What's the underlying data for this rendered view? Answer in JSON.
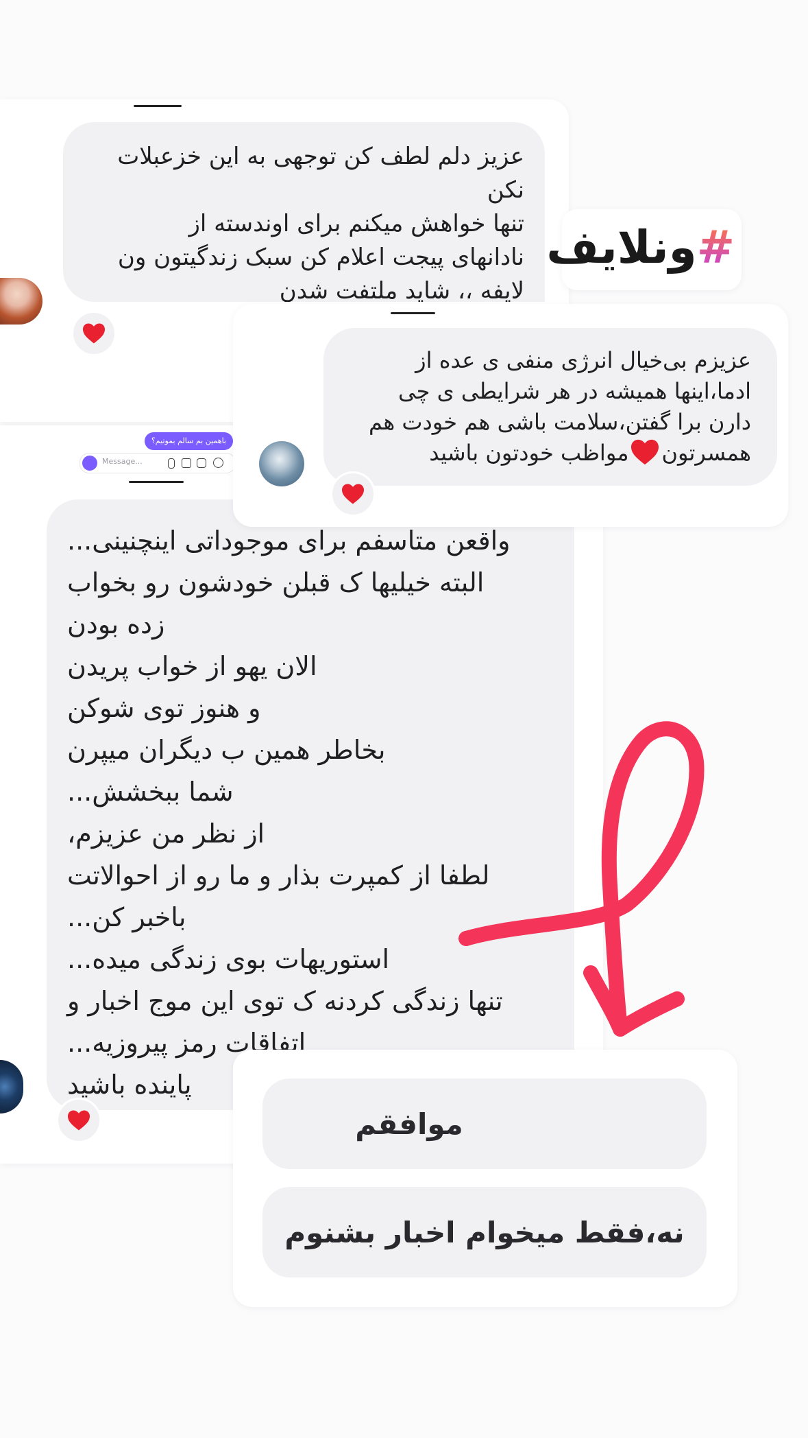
{
  "brand": {
    "logo_text": "ونلایف",
    "hash_symbol": "#"
  },
  "comments": [
    {
      "lines": [
        "عزیز دلم لطف کن توجهی به این خزعبلات",
        "نکن",
        "تنها خواهش میکنم برای اوندسته از",
        "نادانهای پیجت اعلام کن سبک زندگیتون ون",
        "لایفه ،، شاید ملتفت شدن"
      ],
      "reaction": "heart"
    },
    {
      "lines": [
        "عزیزم بی‌خیال انرژی منفی ی عده از",
        "ادما،اینها همیشه در هر شرایطی ی چی",
        "دارن برا گفتن،سلامت باشی هم خودت هم",
        "همسرتون",
        "مواظب خودتون باشید"
      ],
      "reaction": "heart"
    },
    {
      "lines": [
        "واقعن متاسفم برای موجوداتی اینچنینی...",
        "البته خیلیها ک قبلن خودشون رو بخواب",
        "زده بودن",
        "الان یهو از خواب پریدن",
        "و هنوز توی شوکن",
        "بخاطر همین ب دیگران میپرن",
        "شما ببخشش...",
        "از نظر من عزیزم،",
        "لطفا از کمپرت بذار و ما رو از احوالاتت",
        "باخبر کن...",
        "استوریهات بوی زندگی میده...",
        "تنها زندگی کردنه ک توی این موج اخبار و",
        "اتفاقات رمز پیروزیه...",
        "پاینده باشید"
      ],
      "reaction": "heart"
    }
  ],
  "chat_preview": {
    "bubble_text": "باهمین بم سالم بموتیم؟",
    "message_placeholder": "Message..."
  },
  "poll": {
    "options": [
      "موافقم",
      "نه،فقط میخوام اخبار بشنوم"
    ]
  },
  "colors": {
    "heart": "#e8202f",
    "arrow": "#f5345a",
    "bubble": "#f1f1f4",
    "accent_purple": "#7b5cff"
  }
}
